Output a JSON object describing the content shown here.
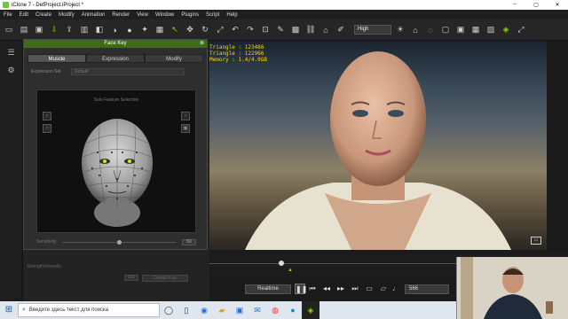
{
  "window": {
    "title": "iClone 7 - DefProject.iProject *",
    "controls": [
      "–",
      "▢",
      "✕"
    ]
  },
  "menu": [
    "File",
    "Edit",
    "Create",
    "Modify",
    "Animation",
    "Render",
    "View",
    "Window",
    "Plugins",
    "Script",
    "Help"
  ],
  "toolbar": {
    "quality_value": "High"
  },
  "face_key": {
    "title": "Face Key",
    "tabs": [
      {
        "label": "Muscle"
      },
      {
        "label": "Expression"
      },
      {
        "label": "Modify"
      }
    ],
    "expression_label": "Expression Sel.",
    "expression_value": "Default",
    "view_title": "Solo Feature Selection",
    "strength_label": "Sensitivity",
    "strength_value": "50",
    "lower_label": "Strength/Intensity",
    "lower_value": "100",
    "default_button": "Default Key"
  },
  "viewport": {
    "stats": [
      "Triangle : 123486",
      "Triangle : 122966",
      "Memory : 1.4/4.0GB"
    ]
  },
  "playback": {
    "mode": "Realtime",
    "frame": "566"
  },
  "taskbar": {
    "search_placeholder": "Введите здесь текст для поиска"
  },
  "colors": {
    "accent": "#8fd400",
    "panel_header": "#3d6b16",
    "stats": "#ffd400"
  }
}
